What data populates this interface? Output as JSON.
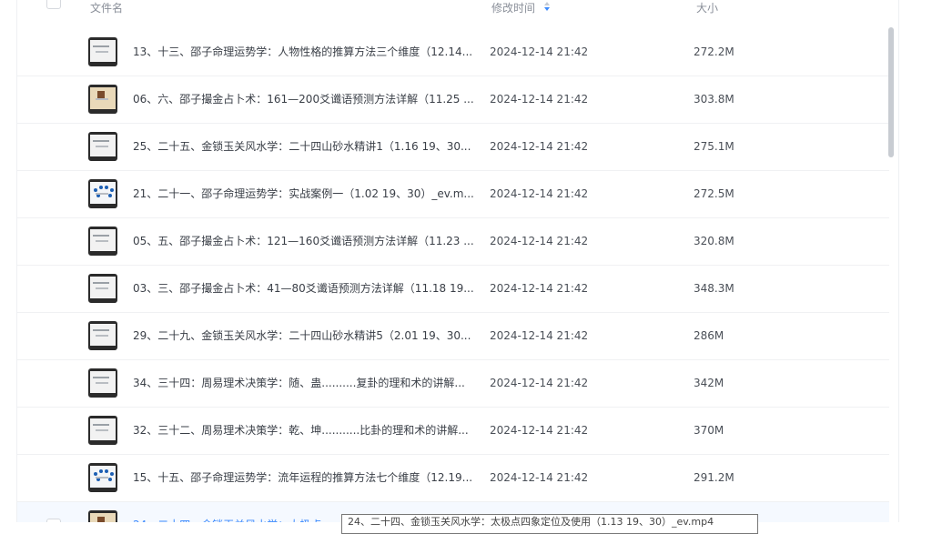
{
  "header": {
    "col_name": "文件名",
    "col_time": "修改时间",
    "col_size": "大小"
  },
  "files": [
    {
      "name": "13、十三、邵子命理运势学：人物性格的推算方法三个维度（12.14...",
      "time": "2024-12-14 21:42",
      "size": "272.2M",
      "thumb": "plain"
    },
    {
      "name": "06、六、邵子撮金占卜术：161—200爻谶语预测方法详解（11.25 ...",
      "time": "2024-12-14 21:42",
      "size": "303.8M",
      "thumb": "colorful"
    },
    {
      "name": "25、二十五、金锁玉关风水学：二十四山砂水精讲1（1.16 19、30...",
      "time": "2024-12-14 21:42",
      "size": "275.1M",
      "thumb": "plain"
    },
    {
      "name": "21、二十一、邵子命理运势学：实战案例一（1.02 19、30）_ev.m...",
      "time": "2024-12-14 21:42",
      "size": "272.5M",
      "thumb": "dotted"
    },
    {
      "name": "05、五、邵子撮金占卜术：121—160爻谶语预测方法详解（11.23 ...",
      "time": "2024-12-14 21:42",
      "size": "320.8M",
      "thumb": "plain"
    },
    {
      "name": "03、三、邵子撮金占卜术：41—80爻谶语预测方法详解（11.18 19...",
      "time": "2024-12-14 21:42",
      "size": "348.3M",
      "thumb": "plain"
    },
    {
      "name": "29、二十九、金锁玉关风水学：二十四山砂水精讲5（2.01 19、30...",
      "time": "2024-12-14 21:42",
      "size": "286M",
      "thumb": "plain"
    },
    {
      "name": "34、三十四：周易理术决策学：随、蛊..........复卦的理和术的讲解...",
      "time": "2024-12-14 21:42",
      "size": "342M",
      "thumb": "plain"
    },
    {
      "name": "32、三十二、周易理术决策学：乾、坤...........比卦的理和术的讲解...",
      "time": "2024-12-14 21:42",
      "size": "370M",
      "thumb": "plain"
    },
    {
      "name": "15、十五、邵子命理运势学：流年运程的推算方法七个维度（12.19...",
      "time": "2024-12-14 21:42",
      "size": "291.2M",
      "thumb": "dotted"
    },
    {
      "name": "24、二十四、金锁玉关风水学：太极点...",
      "time": "",
      "size": "",
      "thumb": "colorful",
      "active": true
    }
  ],
  "tooltip": "24、二十四、金锁玉关风水学：太极点四象定位及使用（1.13 19、30）_ev.mp4",
  "colors": {
    "accent": "#3d8bfd",
    "text": "#3a3f47",
    "header": "#8a8f99"
  }
}
